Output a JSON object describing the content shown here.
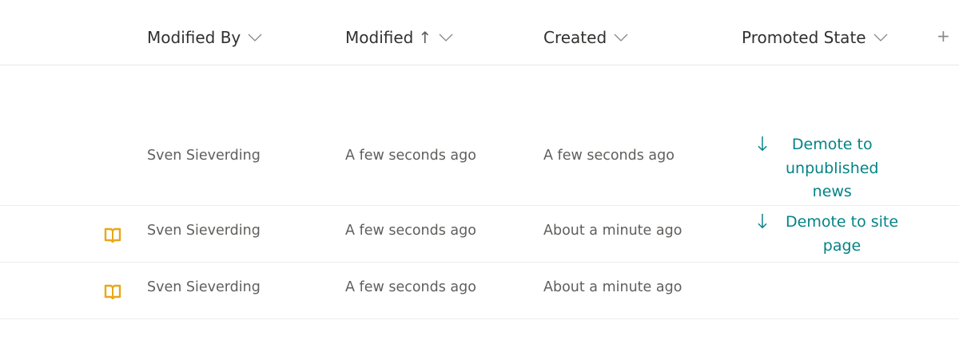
{
  "columns": {
    "modified_by": "Modified By",
    "modified": "Modified",
    "modified_sort": "↑",
    "created": "Created",
    "promoted_state": "Promoted State",
    "add": "+"
  },
  "rows": [
    {
      "modified_by": "Sven Sieverding",
      "modified": "A few seconds ago",
      "created": "A few seconds ago",
      "action": "Demote to unpublished news",
      "action_lines": [
        "Demote to",
        "unpublished",
        "news"
      ]
    },
    {
      "icon": "book-icon",
      "modified_by": "Sven Sieverding",
      "modified": "A few seconds ago",
      "created": "About a minute ago",
      "action": "Demote to site page",
      "action_lines": [
        "Demote to site",
        "page"
      ]
    },
    {
      "icon": "book-icon",
      "modified_by": "Sven Sieverding",
      "modified": "A few seconds ago",
      "created": "About a minute ago"
    }
  ],
  "colors": {
    "accent": "#038387",
    "icon": "#e8a817",
    "text": "#323130",
    "muted": "#605e5c"
  }
}
